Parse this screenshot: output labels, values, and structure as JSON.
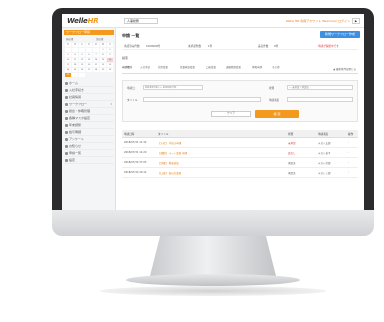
{
  "app": {
    "logo_prefix": "Welle",
    "logo_accent": "HR",
    "company_select": "人事総務",
    "user_text": "Welle HR 専用アカウント  Welcome! ログイン",
    "logout": "▶"
  },
  "sidebar": {
    "header": "ワークフロー申請",
    "cal_prev": "前の月",
    "cal_next": "次の月",
    "cal_days": [
      "日",
      "月",
      "火",
      "水",
      "木",
      "金",
      "土",
      "",
      "",
      "",
      "",
      "",
      "1",
      "2",
      "3",
      "4",
      "5",
      "6",
      "7",
      "8",
      "9",
      "10",
      "11",
      "12",
      "13",
      "14",
      "15",
      "16",
      "17",
      "18",
      "19",
      "20",
      "21",
      "22",
      "23",
      "24",
      "25",
      "26",
      "27",
      "28",
      "29",
      "30",
      "31",
      "",
      ""
    ],
    "menu": [
      {
        "label": "ホーム",
        "arrow": ""
      },
      {
        "label": "入社手続き",
        "arrow": ""
      },
      {
        "label": "社員情報",
        "arrow": ""
      },
      {
        "label": "ワークフロー",
        "arrow": "▾"
      },
      {
        "label": "勤怠・休暇管理",
        "arrow": ""
      },
      {
        "label": "各種マスタ設定",
        "arrow": ""
      },
      {
        "label": "年末調整",
        "arrow": ""
      },
      {
        "label": "給与明細",
        "arrow": ""
      },
      {
        "label": "アンケート",
        "arrow": ""
      },
      {
        "label": "お知らせ",
        "arrow": ""
      },
      {
        "label": "申請一覧",
        "arrow": ""
      },
      {
        "label": "設定",
        "arrow": ""
      }
    ]
  },
  "main": {
    "title": "申請 一覧",
    "primary_button": "新規ワークフロー作成",
    "info": {
      "item1_label": "承認済み件数",
      "item1_value": "1000000件",
      "item2_label": "未承認件数",
      "item2_value": "1件",
      "item3_label": "差戻件数",
      "item3_value": "0件",
      "alert": "申請が保留中です"
    },
    "sub_label": "検索",
    "tabs": [
      "申請種別",
      "入社手続",
      "住所変更",
      "扶養家族変更",
      "口座変更",
      "通勤経路変更",
      "休暇申請",
      "その他"
    ],
    "tab_toggle": "▲ 検索条件を閉じる",
    "search": {
      "date_label": "申請日",
      "date_value": "2018/07/01 ～ 2018/07/31",
      "status_label": "状態",
      "status_value": "— 未承認 / 承認済",
      "title_label": "タイトル",
      "applicant_label": "申請者名",
      "clear": "クリア",
      "search": "検 索"
    },
    "table": {
      "headers": [
        "申請日時",
        "タイトル",
        "",
        "状態",
        "申請者名",
        "操作"
      ],
      "rows": [
        {
          "date": "2018/07/31 11:32",
          "title": "【入社】 手続き申請",
          "status": "未承認",
          "applicant": "テスト太郎",
          "op": "›"
        },
        {
          "date": "2018/07/31 11:20",
          "title": "【通勤】 ルート変更 申請",
          "status": "差戻し",
          "applicant": "テスト花子",
          "op": "›"
        },
        {
          "date": "2018/07/30 17:05",
          "title": "【扶養】 家族追加",
          "status": "承認済",
          "applicant": "テスト次郎",
          "op": "›"
        },
        {
          "date": "2018/07/30 10:12",
          "title": "【口座】 振込先変更",
          "status": "承認済",
          "applicant": "テスト三郎",
          "op": "›"
        }
      ]
    }
  },
  "colors": {
    "brand_orange": "#f39a1e",
    "primary_blue": "#3f8fe0",
    "bezel": "#2b2b2e"
  }
}
